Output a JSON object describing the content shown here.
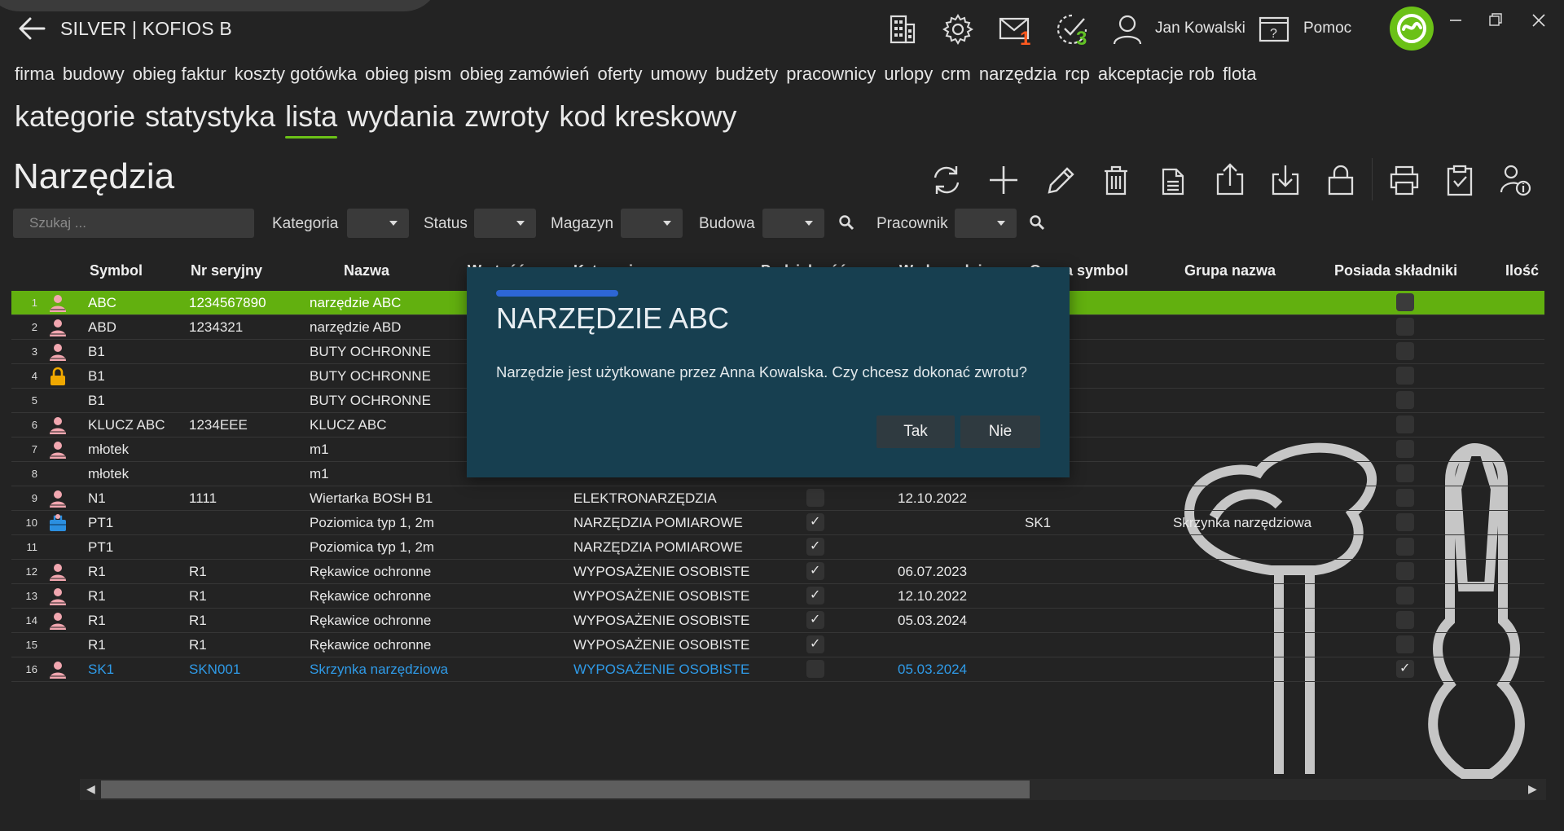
{
  "app": {
    "title": "SILVER | KOFIOS B",
    "user_name": "Jan Kowalski",
    "help_label": "Pomoc",
    "mail_count": "1",
    "tasks_count": "3",
    "accent": "#6bc117"
  },
  "main_nav": [
    "firma",
    "budowy",
    "obieg faktur",
    "koszty gotówka",
    "obieg pism",
    "obieg zamówień",
    "oferty",
    "umowy",
    "budżety",
    "pracownicy",
    "urlopy",
    "crm",
    "narzędzia",
    "rcp",
    "akceptacje rob",
    "flota"
  ],
  "main_nav_active": "narzędzia",
  "sub_nav": [
    "kategorie",
    "statystyka",
    "lista",
    "wydania",
    "zwroty",
    "kod kreskowy"
  ],
  "sub_nav_active": "lista",
  "page_title": "Narzędzia",
  "toolbar_icons": [
    "refresh-icon",
    "add-icon",
    "edit-icon",
    "delete-icon",
    "copy-icon",
    "export-icon",
    "import-icon",
    "lock-icon",
    "print-icon",
    "clipboard-icon",
    "user-info-icon"
  ],
  "filters": {
    "search_placeholder": "Szukaj ...",
    "kategoria": "Kategoria",
    "status": "Status",
    "magazyn": "Magazyn",
    "budowa": "Budowa",
    "pracownik": "Pracownik"
  },
  "columns": {
    "symbol": "Symbol",
    "serial": "Nr seryjny",
    "name": "Nazwa",
    "wartosc": "Wartość",
    "kategoria": "Kategoria",
    "podzielnosc": "Podzielność",
    "wydano": "Wydano dnia",
    "group_symbol": "Grupa symbol",
    "group_name": "Grupa nazwa",
    "has_components": "Posiada składniki",
    "qty": "Ilość"
  },
  "rows": [
    {
      "n": "1",
      "icon": "person",
      "symbol": "ABC",
      "serial": "1234567890",
      "name": "narzędzie ABC",
      "cat": "",
      "podz": "",
      "date": "",
      "gsym": "",
      "gname": "",
      "comp": "empty"
    },
    {
      "n": "2",
      "icon": "person",
      "symbol": "ABD",
      "serial": "1234321",
      "name": "narzędzie ABD",
      "cat": "",
      "podz": "",
      "date": "",
      "gsym": "",
      "gname": "",
      "comp": "empty"
    },
    {
      "n": "3",
      "icon": "person",
      "symbol": "B1",
      "serial": "",
      "name": "BUTY OCHRONNE",
      "cat": "",
      "podz": "",
      "date": "",
      "gsym": "",
      "gname": "",
      "comp": "empty"
    },
    {
      "n": "4",
      "icon": "lock",
      "symbol": "B1",
      "serial": "",
      "name": "BUTY OCHRONNE",
      "cat": "",
      "podz": "",
      "date": "",
      "gsym": "",
      "gname": "",
      "comp": "empty"
    },
    {
      "n": "5",
      "icon": "",
      "symbol": "B1",
      "serial": "",
      "name": "BUTY OCHRONNE",
      "cat": "",
      "podz": "",
      "date": "",
      "gsym": "",
      "gname": "",
      "comp": "empty"
    },
    {
      "n": "6",
      "icon": "person",
      "symbol": "KLUCZ ABC",
      "serial": "1234EEE",
      "name": "KLUCZ ABC",
      "cat": "",
      "podz": "",
      "date": "",
      "gsym": "",
      "gname": "",
      "comp": "empty"
    },
    {
      "n": "7",
      "icon": "person",
      "symbol": "młotek",
      "serial": "",
      "name": "m1",
      "cat": "",
      "podz": "",
      "date": "",
      "gsym": "",
      "gname": "",
      "comp": "empty"
    },
    {
      "n": "8",
      "icon": "",
      "symbol": "młotek",
      "serial": "",
      "name": "m1",
      "cat": "",
      "podz": "",
      "date": "",
      "gsym": "",
      "gname": "",
      "comp": "empty"
    },
    {
      "n": "9",
      "icon": "person",
      "symbol": "N1",
      "serial": "1111",
      "name": "Wiertarka BOSH B1",
      "cat": "ELEKTRONARZĘDZIA",
      "podz": "empty",
      "date": "12.10.2022",
      "gsym": "",
      "gname": "",
      "comp": "empty"
    },
    {
      "n": "10",
      "icon": "toolbox",
      "symbol": "PT1",
      "serial": "",
      "name": "Poziomica typ 1, 2m",
      "cat": "NARZĘDZIA POMIAROWE",
      "podz": "on",
      "date": "",
      "gsym": "SK1",
      "gname": "Skrzynka narzędziowa",
      "comp": "empty"
    },
    {
      "n": "11",
      "icon": "",
      "symbol": "PT1",
      "serial": "",
      "name": "Poziomica typ 1, 2m",
      "cat": "NARZĘDZIA POMIAROWE",
      "podz": "on",
      "date": "",
      "gsym": "",
      "gname": "",
      "comp": "empty"
    },
    {
      "n": "12",
      "icon": "person",
      "symbol": "R1",
      "serial": "R1",
      "name": "Rękawice ochronne",
      "cat": "WYPOSAŻENIE OSOBISTE",
      "podz": "on",
      "date": "06.07.2023",
      "gsym": "",
      "gname": "",
      "comp": "empty"
    },
    {
      "n": "13",
      "icon": "person",
      "symbol": "R1",
      "serial": "R1",
      "name": "Rękawice ochronne",
      "cat": "WYPOSAŻENIE OSOBISTE",
      "podz": "on",
      "date": "12.10.2022",
      "gsym": "",
      "gname": "",
      "comp": "empty"
    },
    {
      "n": "14",
      "icon": "person",
      "symbol": "R1",
      "serial": "R1",
      "name": "Rękawice ochronne",
      "cat": "WYPOSAŻENIE OSOBISTE",
      "podz": "on",
      "date": "05.03.2024",
      "gsym": "",
      "gname": "",
      "comp": "empty"
    },
    {
      "n": "15",
      "icon": "",
      "symbol": "R1",
      "serial": "R1",
      "name": "Rękawice ochronne",
      "cat": "WYPOSAŻENIE OSOBISTE",
      "podz": "on",
      "date": "",
      "gsym": "",
      "gname": "",
      "comp": "empty"
    },
    {
      "n": "16",
      "icon": "person",
      "symbol": "SK1",
      "serial": "SKN001",
      "name": "Skrzynka narzędziowa",
      "cat": "WYPOSAŻENIE OSOBISTE",
      "podz": "empty",
      "date": "05.03.2024",
      "gsym": "",
      "gname": "",
      "comp": "on"
    }
  ],
  "selected_row": "1",
  "highlight_row": "16",
  "modal": {
    "title": "NARZĘDZIE ABC",
    "message": "Narzędzie jest użytkowane przez Anna Kowalska. Czy chcesz dokonać zwrotu?",
    "yes": "Tak",
    "no": "Nie"
  }
}
